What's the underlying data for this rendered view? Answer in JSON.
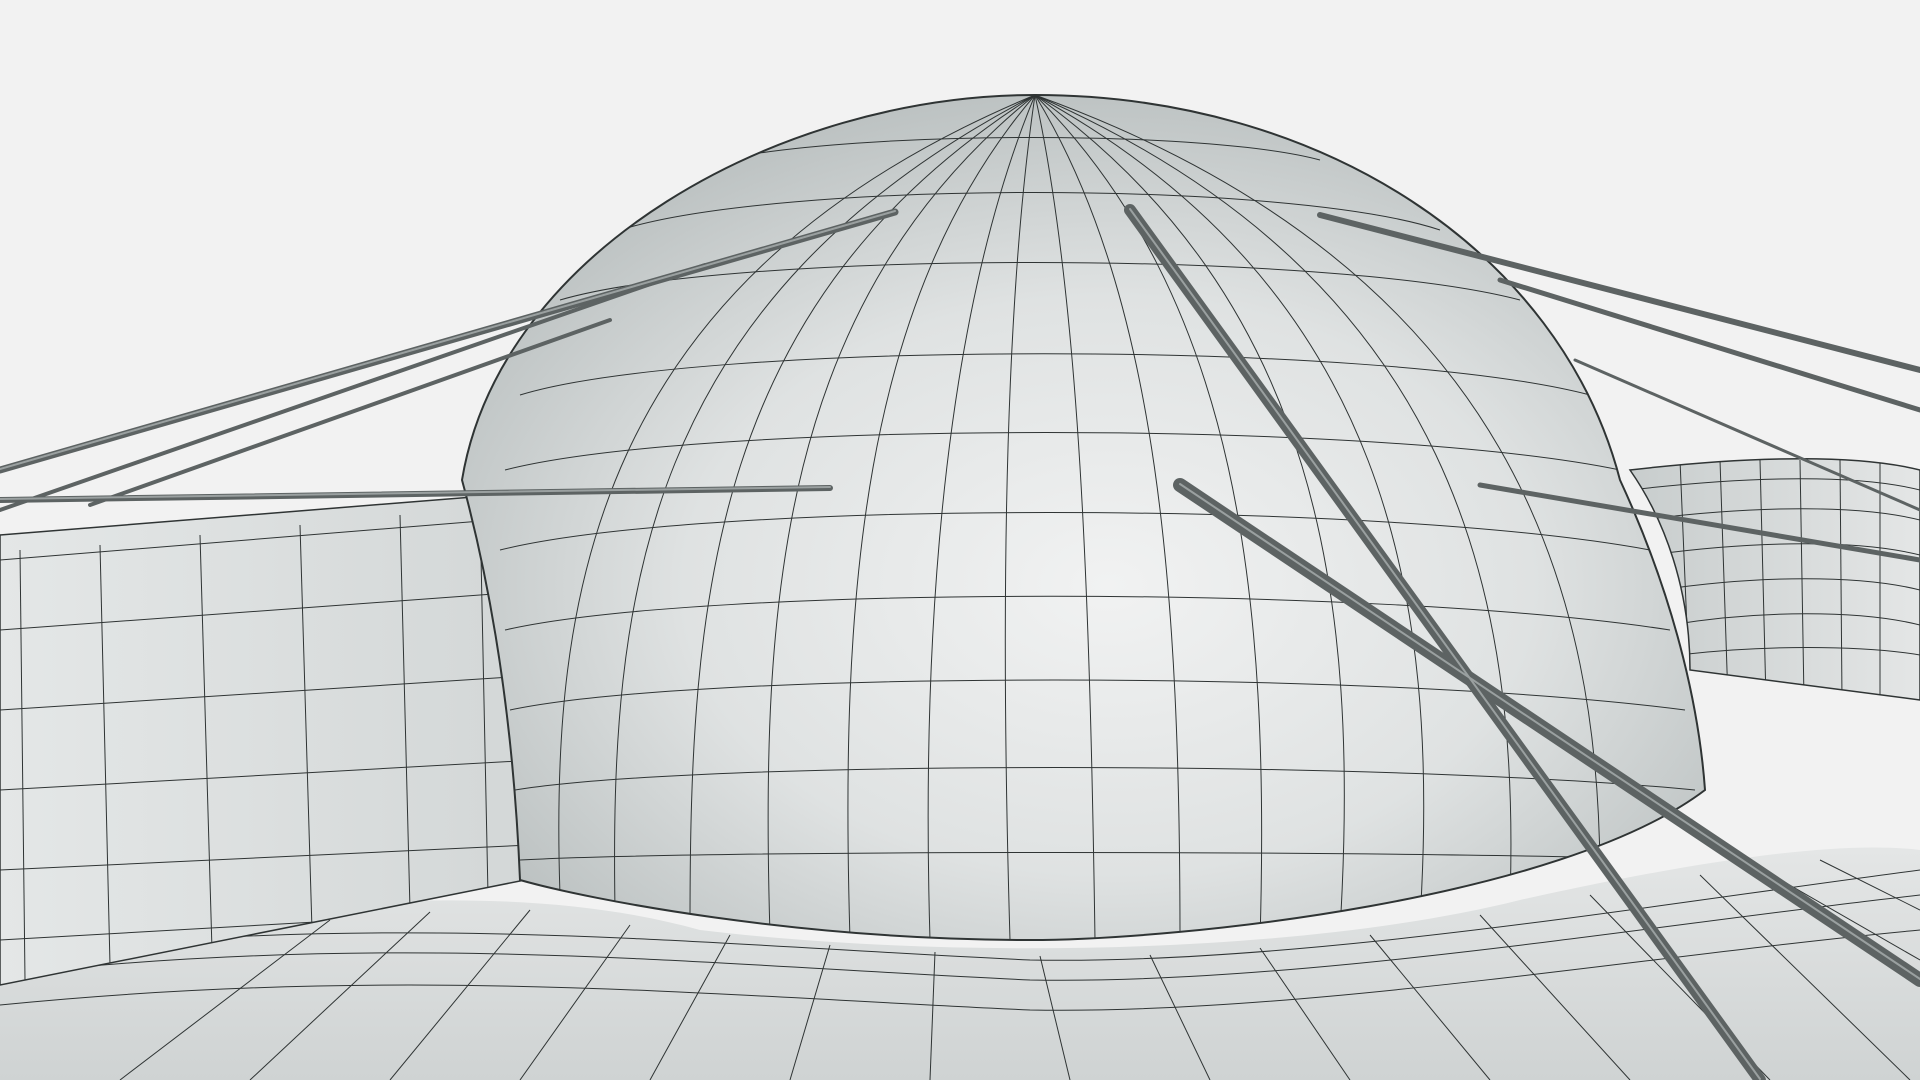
{
  "viewport": {
    "background": "#f2f2f2",
    "mesh_fill": "#d9dcdc",
    "mesh_shadow": "#bfc4c4",
    "wire_color": "#2f3434",
    "rod_color": "#5d6363"
  },
  "scene_objects": [
    "dome-mesh",
    "left-wall-mesh",
    "right-wall-mesh",
    "floor-mesh",
    "support-rods"
  ]
}
